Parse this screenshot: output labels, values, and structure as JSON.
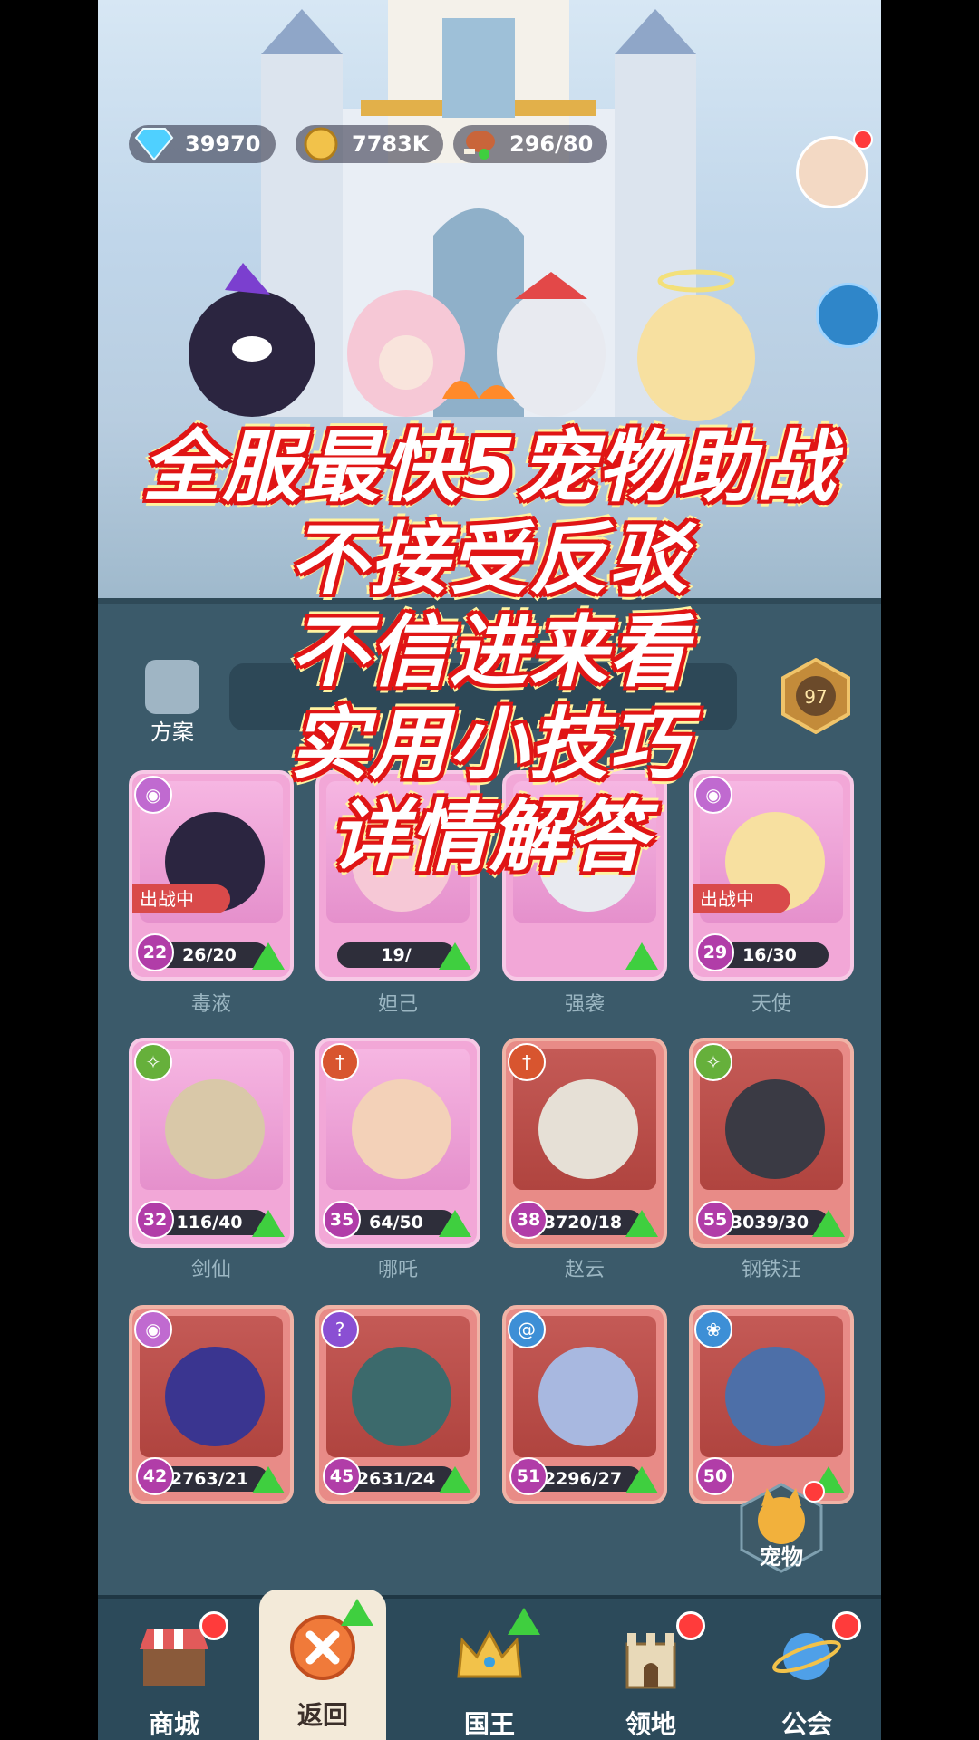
{
  "resources": [
    {
      "icon": "diamond-icon",
      "value": "39970"
    },
    {
      "icon": "gold-coin-icon",
      "value": "7783K"
    },
    {
      "icon": "meat-icon",
      "value": "296/80"
    }
  ],
  "overlay_lines": [
    "全服最快5宠物助战",
    "不接受反驳",
    "不信进来看",
    "实用小技巧",
    "详情解答"
  ],
  "plan_label": "方案",
  "team_level": "97",
  "pets": [
    {
      "name": "毒液",
      "level": "22",
      "progress": "26/20",
      "status": "出战中",
      "type_icon": "eye-icon"
    },
    {
      "name": "妲己",
      "level": "",
      "progress": "19/",
      "status": "",
      "type_icon": "eye-icon"
    },
    {
      "name": "强袭",
      "level": "",
      "progress": "",
      "status": "",
      "type_icon": "eye-icon"
    },
    {
      "name": "天使",
      "level": "29",
      "progress": "16/30",
      "status": "出战中",
      "type_icon": "eye-icon"
    },
    {
      "name": "剑仙",
      "level": "32",
      "progress": "116/40",
      "status": "",
      "type_icon": "star-icon"
    },
    {
      "name": "哪吒",
      "level": "35",
      "progress": "64/50",
      "status": "",
      "type_icon": "sword-icon"
    },
    {
      "name": "赵云",
      "level": "38",
      "progress": "3720/18",
      "status": "",
      "type_icon": "sword-icon"
    },
    {
      "name": "钢铁汪",
      "level": "55",
      "progress": "3039/30",
      "status": "",
      "type_icon": "star-icon"
    },
    {
      "name": "",
      "level": "42",
      "progress": "2763/21",
      "status": "",
      "type_icon": "eye-icon"
    },
    {
      "name": "",
      "level": "45",
      "progress": "2631/24",
      "status": "",
      "type_icon": "question-icon"
    },
    {
      "name": "",
      "level": "51",
      "progress": "2296/27",
      "status": "",
      "type_icon": "spiral-icon"
    },
    {
      "name": "",
      "level": "50",
      "progress": "",
      "status": "",
      "type_icon": "paw-icon"
    }
  ],
  "pet_button_label": "宠物",
  "nav": [
    {
      "label": "商城",
      "icon": "shop-icon",
      "badge": "red-dot"
    },
    {
      "label": "返回",
      "icon": "close-icon",
      "badge": "green-arrow"
    },
    {
      "label": "国王",
      "icon": "crown-icon",
      "badge": "green-arrow"
    },
    {
      "label": "领地",
      "icon": "castle-icon",
      "badge": "red-dot"
    },
    {
      "label": "公会",
      "icon": "planet-icon",
      "badge": "red-dot"
    }
  ],
  "colors": {
    "overlay_stroke": "#e01515",
    "overlay_glow": "#fff3a0",
    "panel": "#3b5a6a",
    "nav": "#2c4a5a"
  }
}
